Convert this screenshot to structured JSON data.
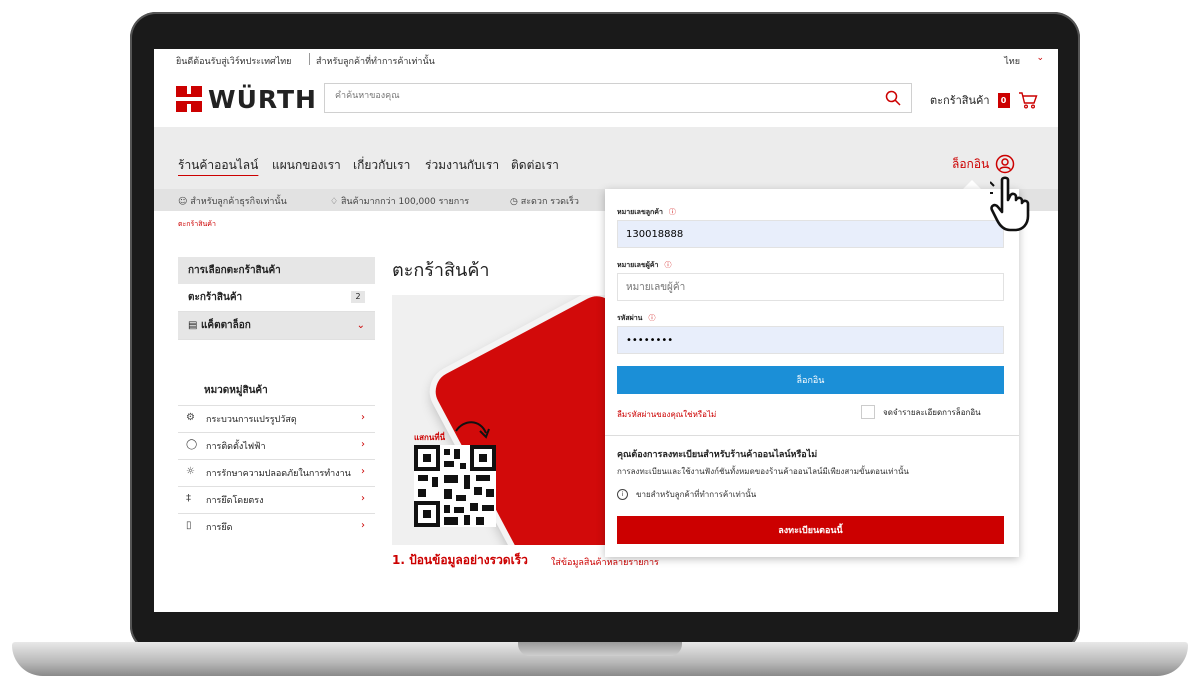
{
  "topbar": {
    "welcome": "ยินดีต้อนรับสู่เวิร์ทประเทศไทย",
    "business_only": "สำหรับลูกค้าที่ทำการค้าเท่านั้น",
    "language": "ไทย"
  },
  "header": {
    "logo": "WÜRTH",
    "search_placeholder": "คำค้นหาของคุณ",
    "cart_label": "ตะกร้าสินค้า",
    "cart_count": "0"
  },
  "nav": {
    "items": [
      "ร้านค้าออนไลน์",
      "แผนกของเรา",
      "เกี่ยวกับเรา",
      "ร่วมงานกับเรา",
      "ติดต่อเรา"
    ],
    "login": "ล็อกอิน"
  },
  "benefits": [
    "สำหรับลูกค้าธุรกิจเท่านั้น",
    "สินค้ามากกว่า 100,000 รายการ",
    "สะดวก รวดเร็ว"
  ],
  "breadcrumb": "ตะกร้าสินค้า",
  "sidebar": {
    "heading": "การเลือกตะกร้าสินค้า",
    "cart_item": "ตะกร้าสินค้า",
    "cart_item_count": "2",
    "catalog": "แค็ตตาล็อก",
    "categories_title": "หมวดหมู่สินค้า",
    "categories": [
      "กระบวนการแปรรูปวัสดุ",
      "การติดตั้งไฟฟ้า",
      "การรักษาความปลอดภัยในการทำงาน",
      "การยึดโดยตรง",
      "การยึด"
    ]
  },
  "main": {
    "title": "ตะกร้าสินค้า",
    "scan_here": "แสกนที่นี่",
    "step_title": "1. ป้อนข้อมูลอย่างรวดเร็ว",
    "step_sub": "ใส่ข้อมูลสินค้าหลายรายการ"
  },
  "login_panel": {
    "customer_no_label": "หมายเลขลูกค้า",
    "customer_no_value": "130018888",
    "user_no_label": "หมายเลขผู้ค้า",
    "user_no_placeholder": "หมายเลขผู้ค้า",
    "password_label": "รหัสผ่าน",
    "password_value": "••••••••",
    "login_button": "ล็อกอิน",
    "forgot": "ลืมรหัสผ่านของคุณใช่หรือไม่",
    "remember": "จดจำรายละเอียดการล็อกอิน",
    "register_question": "คุณต้องการลงทะเบียนสำหรับร้านค้าออนไลน์หรือไม่",
    "register_desc": "การลงทะเบียนและใช้งานฟังก์ชันทั้งหมดของร้านค้าออนไลน์มีเพียงสามขั้นตอนเท่านั้น",
    "register_note": "ขายสำหรับลูกค้าที่ทำการค้าเท่านั้น",
    "register_button": "ลงทะเบียนตอนนี้"
  },
  "colors": {
    "brand_red": "#cc0000",
    "login_blue": "#1b8fd7"
  }
}
